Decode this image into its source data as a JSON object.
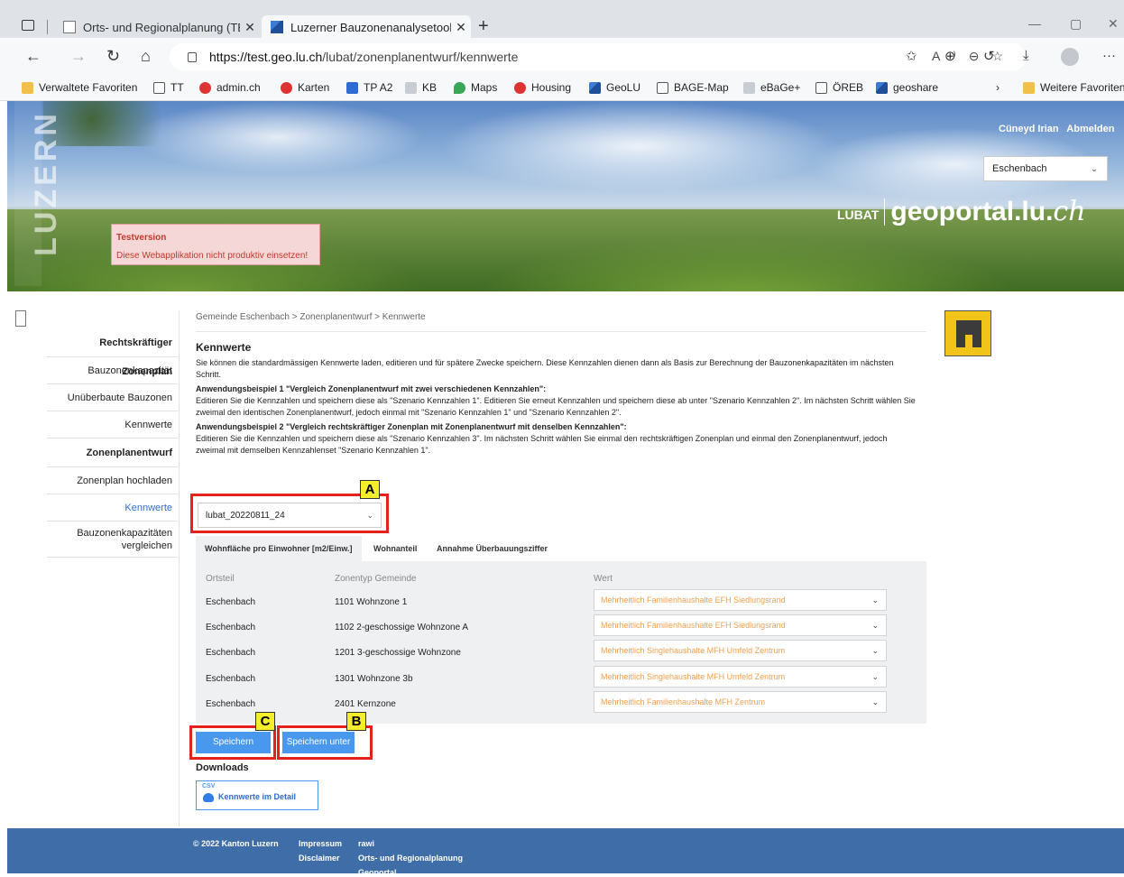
{
  "browser": {
    "tabs": [
      {
        "title": "Orts- und Regionalplanung (TEST",
        "close": "✕"
      },
      {
        "title": "Luzerner Bauzonenanalysetool (L",
        "close": "✕"
      }
    ],
    "new_tab": "+",
    "url_host": "https://test.geo.lu.ch",
    "url_path": "/lubat/zonenplanentwurf/kennwerte",
    "bookmarks": [
      {
        "label": "Verwaltete Favoriten",
        "icon": "folder-icon"
      },
      {
        "label": "TT",
        "icon": "file-icon"
      },
      {
        "label": "admin.ch",
        "icon": "swiss-cross-icon"
      },
      {
        "label": "Karten",
        "icon": "swiss-cross-icon"
      },
      {
        "label": "TP A2",
        "icon": "app-icon"
      },
      {
        "label": "KB",
        "icon": "page-icon"
      },
      {
        "label": "Maps",
        "icon": "map-pin-icon"
      },
      {
        "label": "Housing",
        "icon": "swiss-cross-icon"
      },
      {
        "label": "GeoLU",
        "icon": "geolu-icon"
      },
      {
        "label": "BAGE-Map",
        "icon": "page-icon"
      },
      {
        "label": "eBaGe+",
        "icon": "page-icon"
      },
      {
        "label": "ÖREB",
        "icon": "page-icon"
      },
      {
        "label": "geoshare",
        "icon": "geolu-icon"
      }
    ],
    "more_bookmarks": "Weitere Favoriten"
  },
  "header": {
    "side_brand": "LUZERN",
    "user_name": "Cüneyd Irian",
    "logout": "Abmelden",
    "municipality": "Eschenbach",
    "brand_lubat": "LUBAT",
    "brand_geo": "geoportal.lu.",
    "brand_ch": "ch",
    "test_title": "Testversion",
    "test_text": "Diese Webapplikation nicht produktiv einsetzen!"
  },
  "sidebar": {
    "items": [
      {
        "label": "Rechtskräftiger Zonenplan"
      },
      {
        "label": "Bauzonenkapazität"
      },
      {
        "label": "Unüberbaute Bauzonen"
      },
      {
        "label": "Kennwerte"
      },
      {
        "label": "Zonenplanentwurf"
      },
      {
        "label": "Zonenplan hochladen"
      },
      {
        "label": "Kennwerte"
      },
      {
        "label": "Bauzonenkapazitäten vergleichen"
      }
    ]
  },
  "main": {
    "breadcrumb": "Gemeinde Eschenbach > Zonenplanentwurf > Kennwerte",
    "title": "Kennwerte",
    "intro": "Sie können die standardmässigen Kennwerte laden, editieren und für spätere Zwecke speichern. Diese Kennzahlen dienen dann als Basis zur Berechnung der Bauzonenkapazitäten im nächsten Schritt.",
    "example1_title": "Anwendungsbeispiel 1 \"Vergleich Zonenplanentwurf mit zwei verschiedenen Kennzahlen\":",
    "example1_text": "Editieren Sie die Kennzahlen und speichern diese als \"Szenario Kennzahlen 1\". Editieren Sie erneut Kennzahlen und speichern diese ab unter \"Szenario Kennzahlen 2\". Im nächsten Schritt wählen Sie zweimal den identischen Zonenplanentwurf, jedoch einmal mit \"Szenario Kennzahlen 1\" und \"Szenario Kennzahlen 2\".",
    "example2_title": "Anwendungsbeispiel 2 \"Vergleich rechtskräftiger Zonenplan mit Zonenplanentwurf mit denselben Kennzahlen\":",
    "example2_text": "Editieren Sie die Kennzahlen und speichern diese als \"Szenario Kennzahlen 3\". Im nächsten Schritt wählen Sie einmal den rechtskräftigen Zonenplan und einmal den Zonenplanentwurf, jedoch zweimal mit demselben Kennzahlenset \"Szenario Kennzahlen 1\".",
    "kennwert_set": "lubat_20220811_24",
    "tabs": [
      "Wohnfläche pro Einwohner [m2/Einw.]",
      "Wohnanteil",
      "Annahme Überbauungsziffer"
    ],
    "table_headers": [
      "Ortsteil",
      "Zonentyp Gemeinde",
      "Wert"
    ],
    "rows": [
      {
        "ortsteil": "Eschenbach",
        "zonentyp": "1101 Wohnzone 1",
        "wert": "Mehrheitlich Familienhaushalte EFH Siedlungsrand"
      },
      {
        "ortsteil": "Eschenbach",
        "zonentyp": "1102 2-geschossige Wohnzone A",
        "wert": "Mehrheitlich Familienhaushalte EFH Siedlungsrand"
      },
      {
        "ortsteil": "Eschenbach",
        "zonentyp": "1201 3-geschossige Wohnzone",
        "wert": "Mehrheitlich Singlehaushalte MFH Umfeld Zentrum"
      },
      {
        "ortsteil": "Eschenbach",
        "zonentyp": "1301 Wohnzone 3b",
        "wert": "Mehrheitlich Singlehaushalte MFH Umfeld Zentrum"
      },
      {
        "ortsteil": "Eschenbach",
        "zonentyp": "2401 Kernzone",
        "wert": "Mehrheitlich Familienhaushalte MFH Zentrum"
      }
    ],
    "save": "Speichern",
    "save_as": "Speichern unter",
    "downloads_title": "Downloads",
    "csv_tag": "CSV",
    "csv_label": "Kennwerte im Detail"
  },
  "annotations": {
    "a": "A",
    "b": "B",
    "c": "C",
    "box_color": "#e4211b",
    "marker_color": "#f5ee2a"
  },
  "footer": {
    "copyright": "© 2022 Kanton Luzern",
    "impressum": "Impressum",
    "disclaimer": "Disclaimer",
    "rawi": "rawi",
    "orts": "Orts- und Regionalplanung",
    "geoportal": "Geoportal"
  }
}
